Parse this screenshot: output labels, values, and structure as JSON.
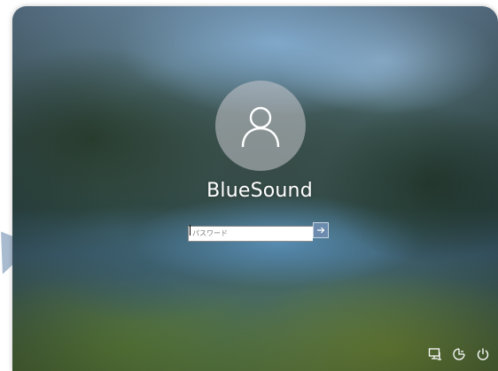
{
  "lock_screen": {
    "username": "BlueSound",
    "password": {
      "placeholder": "パスワード",
      "value": ""
    },
    "submit_icon": "arrow-right-icon",
    "avatar_icon": "user-avatar-icon",
    "corner_icons": [
      "network-icon",
      "ease-of-access-icon",
      "power-icon"
    ]
  },
  "colors": {
    "avatar_bg": "#c8c8cd",
    "submit_bg": "#6e8caf",
    "pointer_arrow": "#a9bccf"
  }
}
